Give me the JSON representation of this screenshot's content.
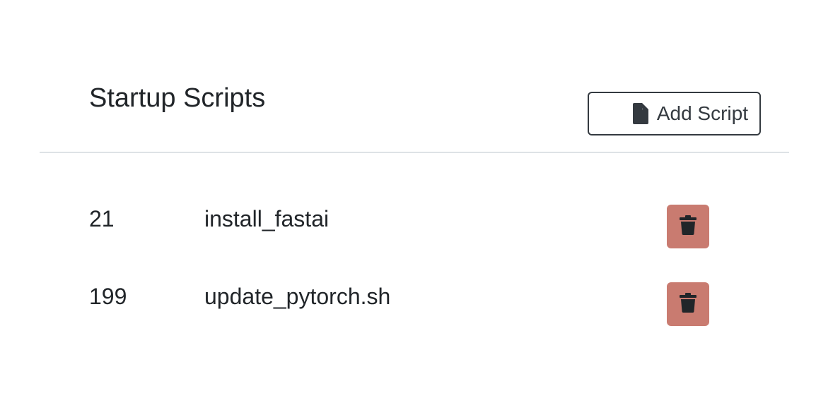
{
  "header": {
    "title": "Startup Scripts",
    "add_button": {
      "label": "Add Script",
      "icon": "file-icon"
    }
  },
  "scripts": [
    {
      "id": "21",
      "name": "install_fastai",
      "delete_icon": "trash-icon"
    },
    {
      "id": "199",
      "name": "update_pytorch.sh",
      "delete_icon": "trash-icon"
    }
  ],
  "colors": {
    "delete_button_bg": "#c97b70",
    "icon_dark": "#212529",
    "divider": "#dee2e6"
  }
}
